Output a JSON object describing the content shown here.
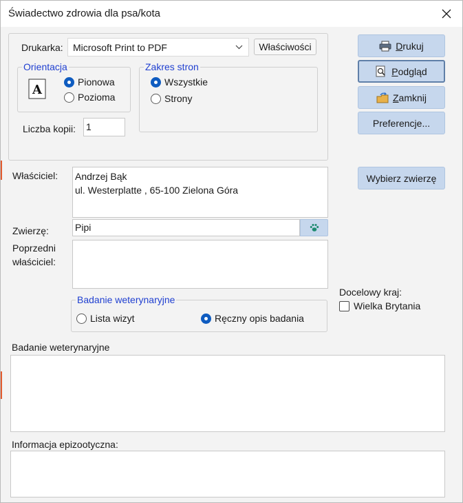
{
  "window": {
    "title": "Świadectwo zdrowia dla psa/kota"
  },
  "print": {
    "printer_label": "Drukarka:",
    "printer_value": "Microsoft Print to PDF",
    "properties_button": "Właściwości",
    "orientation": {
      "legend": "Orientacja",
      "options": [
        "Pionowa",
        "Pozioma"
      ],
      "selected": "Pionowa"
    },
    "range": {
      "legend": "Zakres stron",
      "options": [
        "Wszystkie",
        "Strony"
      ],
      "selected": "Wszystkie"
    },
    "copies_label": "Liczba kopii:",
    "copies_value": "1"
  },
  "buttons": {
    "print": {
      "label": "Drukuj",
      "accel": "D"
    },
    "preview": {
      "label": "Podgląd",
      "accel": "P"
    },
    "close": {
      "label": "Zamknij",
      "accel": "Z"
    },
    "preferences": {
      "label": "Preferencje..."
    },
    "choose_animal": {
      "label": "Wybierz zwierzę"
    }
  },
  "owner": {
    "label": "Właściciel:",
    "line1": "Andrzej Bąk",
    "line2": "ul. Westerplatte , 65-100 Zielona Góra"
  },
  "animal": {
    "label": "Zwierzę:",
    "value": "Pipi",
    "icon": "paw-icon"
  },
  "previous_owner": {
    "label_line1": "Poprzedni",
    "label_line2": "właściciel:",
    "value": ""
  },
  "destination": {
    "label": "Docelowy kraj:",
    "option": "Wielka Brytania",
    "checked": false
  },
  "vet_exam": {
    "legend": "Badanie weterynaryjne",
    "options": [
      "Lista wizyt",
      "Ręczny opis badania"
    ],
    "selected": "Ręczny opis badania"
  },
  "exam_text": {
    "label": "Badanie weterynaryjne",
    "value": ""
  },
  "epizootic": {
    "label": "Informacja epizootyczna:",
    "value": ""
  },
  "colors": {
    "accent": "#0f5cc0",
    "button_bg": "#c6d7ed",
    "legend": "#1f3fd0"
  }
}
